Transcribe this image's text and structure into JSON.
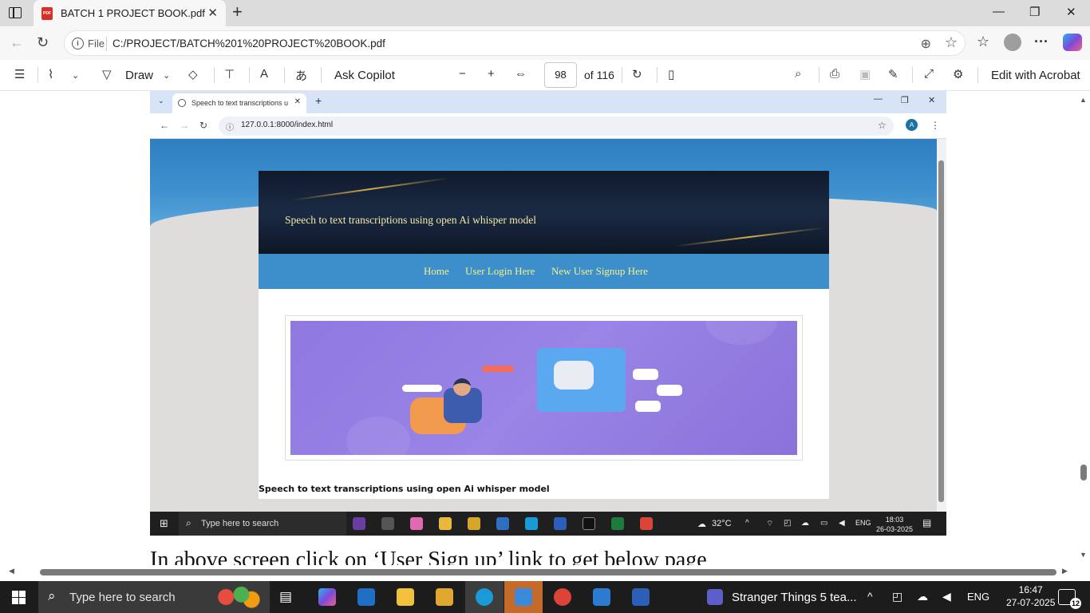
{
  "browser": {
    "tab_title": "BATCH 1 PROJECT BOOK.pdf",
    "file_label": "File",
    "url": "C:/PROJECT/BATCH%201%20PROJECT%20BOOK.pdf"
  },
  "pdf_toolbar": {
    "draw_label": "Draw",
    "ask_copilot_label": "Ask Copilot",
    "page_number": "98",
    "page_total": "of 116",
    "edit_acrobat_label": "Edit with Acrobat"
  },
  "inner_browser": {
    "tab_title": "Speech to text transcriptions u",
    "url": "127.0.0.1:8000/index.html",
    "avatar_letter": "A"
  },
  "site": {
    "header_title": "Speech to text transcriptions using open Ai whisper model",
    "nav": [
      "Home",
      "User Login Here",
      "New User Signup Here"
    ],
    "footer_text": "Speech to text transcriptions using open Ai whisper model"
  },
  "inner_taskbar": {
    "search_placeholder": "Type here to search",
    "weather": "32°C",
    "lang": "ENG",
    "time": "18:03",
    "date": "26-03-2025"
  },
  "document": {
    "caption_text": "In above screen click on ‘User Sign up’ link to get below page"
  },
  "taskbar": {
    "search_placeholder": "Type here to search",
    "media_title": "Stranger Things 5 tea...",
    "lang": "ENG",
    "time": "16:47",
    "date": "27-07-2025",
    "notification_count": "12"
  },
  "colors": {
    "pdf_icon": "#d93025",
    "nav_link": "#f5f08a",
    "header_title": "#f3e9a8",
    "nav_bar": "#3d8fcc",
    "hero": "#8f79e0"
  }
}
